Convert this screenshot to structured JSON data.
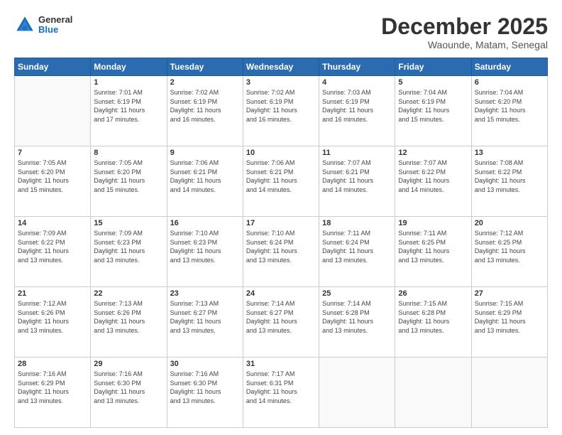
{
  "header": {
    "logo": {
      "general": "General",
      "blue": "Blue"
    },
    "title": "December 2025",
    "location": "Waounde, Matam, Senegal"
  },
  "weekdays": [
    "Sunday",
    "Monday",
    "Tuesday",
    "Wednesday",
    "Thursday",
    "Friday",
    "Saturday"
  ],
  "weeks": [
    [
      {
        "day": "",
        "info": ""
      },
      {
        "day": "1",
        "info": "Sunrise: 7:01 AM\nSunset: 6:19 PM\nDaylight: 11 hours\nand 17 minutes."
      },
      {
        "day": "2",
        "info": "Sunrise: 7:02 AM\nSunset: 6:19 PM\nDaylight: 11 hours\nand 16 minutes."
      },
      {
        "day": "3",
        "info": "Sunrise: 7:02 AM\nSunset: 6:19 PM\nDaylight: 11 hours\nand 16 minutes."
      },
      {
        "day": "4",
        "info": "Sunrise: 7:03 AM\nSunset: 6:19 PM\nDaylight: 11 hours\nand 16 minutes."
      },
      {
        "day": "5",
        "info": "Sunrise: 7:04 AM\nSunset: 6:19 PM\nDaylight: 11 hours\nand 15 minutes."
      },
      {
        "day": "6",
        "info": "Sunrise: 7:04 AM\nSunset: 6:20 PM\nDaylight: 11 hours\nand 15 minutes."
      }
    ],
    [
      {
        "day": "7",
        "info": "Sunrise: 7:05 AM\nSunset: 6:20 PM\nDaylight: 11 hours\nand 15 minutes."
      },
      {
        "day": "8",
        "info": "Sunrise: 7:05 AM\nSunset: 6:20 PM\nDaylight: 11 hours\nand 15 minutes."
      },
      {
        "day": "9",
        "info": "Sunrise: 7:06 AM\nSunset: 6:21 PM\nDaylight: 11 hours\nand 14 minutes."
      },
      {
        "day": "10",
        "info": "Sunrise: 7:06 AM\nSunset: 6:21 PM\nDaylight: 11 hours\nand 14 minutes."
      },
      {
        "day": "11",
        "info": "Sunrise: 7:07 AM\nSunset: 6:21 PM\nDaylight: 11 hours\nand 14 minutes."
      },
      {
        "day": "12",
        "info": "Sunrise: 7:07 AM\nSunset: 6:22 PM\nDaylight: 11 hours\nand 14 minutes."
      },
      {
        "day": "13",
        "info": "Sunrise: 7:08 AM\nSunset: 6:22 PM\nDaylight: 11 hours\nand 13 minutes."
      }
    ],
    [
      {
        "day": "14",
        "info": "Sunrise: 7:09 AM\nSunset: 6:22 PM\nDaylight: 11 hours\nand 13 minutes."
      },
      {
        "day": "15",
        "info": "Sunrise: 7:09 AM\nSunset: 6:23 PM\nDaylight: 11 hours\nand 13 minutes."
      },
      {
        "day": "16",
        "info": "Sunrise: 7:10 AM\nSunset: 6:23 PM\nDaylight: 11 hours\nand 13 minutes."
      },
      {
        "day": "17",
        "info": "Sunrise: 7:10 AM\nSunset: 6:24 PM\nDaylight: 11 hours\nand 13 minutes."
      },
      {
        "day": "18",
        "info": "Sunrise: 7:11 AM\nSunset: 6:24 PM\nDaylight: 11 hours\nand 13 minutes."
      },
      {
        "day": "19",
        "info": "Sunrise: 7:11 AM\nSunset: 6:25 PM\nDaylight: 11 hours\nand 13 minutes."
      },
      {
        "day": "20",
        "info": "Sunrise: 7:12 AM\nSunset: 6:25 PM\nDaylight: 11 hours\nand 13 minutes."
      }
    ],
    [
      {
        "day": "21",
        "info": "Sunrise: 7:12 AM\nSunset: 6:26 PM\nDaylight: 11 hours\nand 13 minutes."
      },
      {
        "day": "22",
        "info": "Sunrise: 7:13 AM\nSunset: 6:26 PM\nDaylight: 11 hours\nand 13 minutes."
      },
      {
        "day": "23",
        "info": "Sunrise: 7:13 AM\nSunset: 6:27 PM\nDaylight: 11 hours\nand 13 minutes."
      },
      {
        "day": "24",
        "info": "Sunrise: 7:14 AM\nSunset: 6:27 PM\nDaylight: 11 hours\nand 13 minutes."
      },
      {
        "day": "25",
        "info": "Sunrise: 7:14 AM\nSunset: 6:28 PM\nDaylight: 11 hours\nand 13 minutes."
      },
      {
        "day": "26",
        "info": "Sunrise: 7:15 AM\nSunset: 6:28 PM\nDaylight: 11 hours\nand 13 minutes."
      },
      {
        "day": "27",
        "info": "Sunrise: 7:15 AM\nSunset: 6:29 PM\nDaylight: 11 hours\nand 13 minutes."
      }
    ],
    [
      {
        "day": "28",
        "info": "Sunrise: 7:16 AM\nSunset: 6:29 PM\nDaylight: 11 hours\nand 13 minutes."
      },
      {
        "day": "29",
        "info": "Sunrise: 7:16 AM\nSunset: 6:30 PM\nDaylight: 11 hours\nand 13 minutes."
      },
      {
        "day": "30",
        "info": "Sunrise: 7:16 AM\nSunset: 6:30 PM\nDaylight: 11 hours\nand 13 minutes."
      },
      {
        "day": "31",
        "info": "Sunrise: 7:17 AM\nSunset: 6:31 PM\nDaylight: 11 hours\nand 14 minutes."
      },
      {
        "day": "",
        "info": ""
      },
      {
        "day": "",
        "info": ""
      },
      {
        "day": "",
        "info": ""
      }
    ]
  ]
}
